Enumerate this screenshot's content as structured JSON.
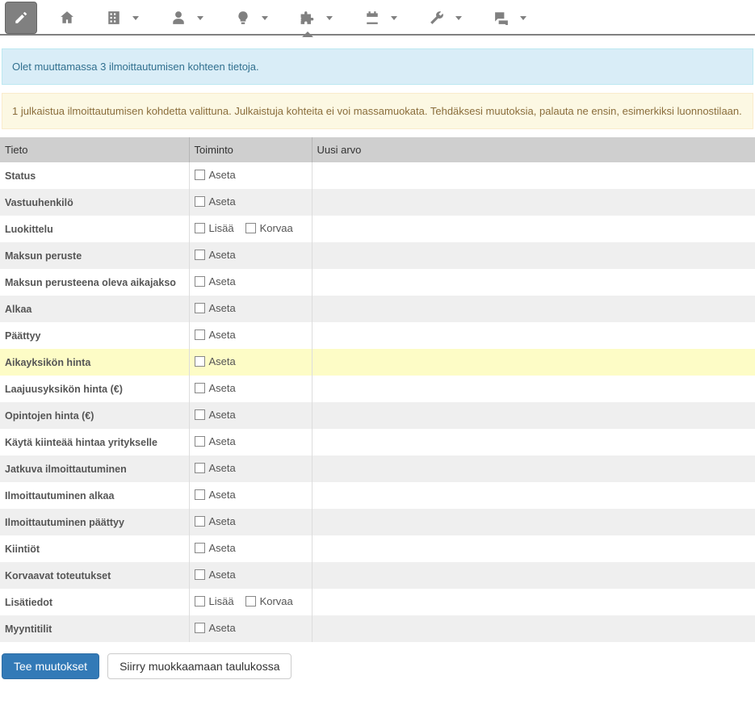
{
  "alerts": {
    "info": "Olet muuttamassa 3 ilmoittautumisen kohteen tietoja.",
    "warn": "1 julkaistua ilmoittautumisen kohdetta valittuna. Julkaistuja kohteita ei voi massamuokata. Tehdäksesi muutoksia, palauta ne ensin, esimerkiksi luonnostilaan."
  },
  "headers": {
    "field": "Tieto",
    "action": "Toiminto",
    "value": "Uusi arvo"
  },
  "actions": {
    "set": "Aseta",
    "add": "Lisää",
    "replace": "Korvaa"
  },
  "rows": [
    {
      "label": "Status",
      "type": "set",
      "alt": true
    },
    {
      "label": "Vastuuhenkilö",
      "type": "set",
      "alt": false
    },
    {
      "label": "Luokittelu",
      "type": "addreplace",
      "alt": true
    },
    {
      "label": "Maksun peruste",
      "type": "set",
      "alt": false
    },
    {
      "label": "Maksun perusteena oleva aikajakso",
      "type": "set",
      "alt": true
    },
    {
      "label": "Alkaa",
      "type": "set",
      "alt": false
    },
    {
      "label": "Päättyy",
      "type": "set",
      "alt": true
    },
    {
      "label": "Aikayksikön hinta",
      "type": "set",
      "alt": false,
      "hl": true
    },
    {
      "label": "Laajuusyksikön hinta (€)",
      "type": "set",
      "alt": true
    },
    {
      "label": "Opintojen hinta (€)",
      "type": "set",
      "alt": false
    },
    {
      "label": "Käytä kiinteää hintaa yritykselle",
      "type": "set",
      "alt": true
    },
    {
      "label": "Jatkuva ilmoittautuminen",
      "type": "set",
      "alt": false
    },
    {
      "label": "Ilmoittautuminen alkaa",
      "type": "set",
      "alt": true
    },
    {
      "label": "Ilmoittautuminen päättyy",
      "type": "set",
      "alt": false
    },
    {
      "label": "Kiintiöt",
      "type": "set",
      "alt": true
    },
    {
      "label": "Korvaavat toteutukset",
      "type": "set",
      "alt": false
    },
    {
      "label": "Lisätiedot",
      "type": "addreplace",
      "alt": true
    },
    {
      "label": "Myyntitilit",
      "type": "set",
      "alt": false
    }
  ],
  "buttons": {
    "apply": "Tee muutokset",
    "edit_table": "Siirry muokkaamaan taulukossa"
  }
}
